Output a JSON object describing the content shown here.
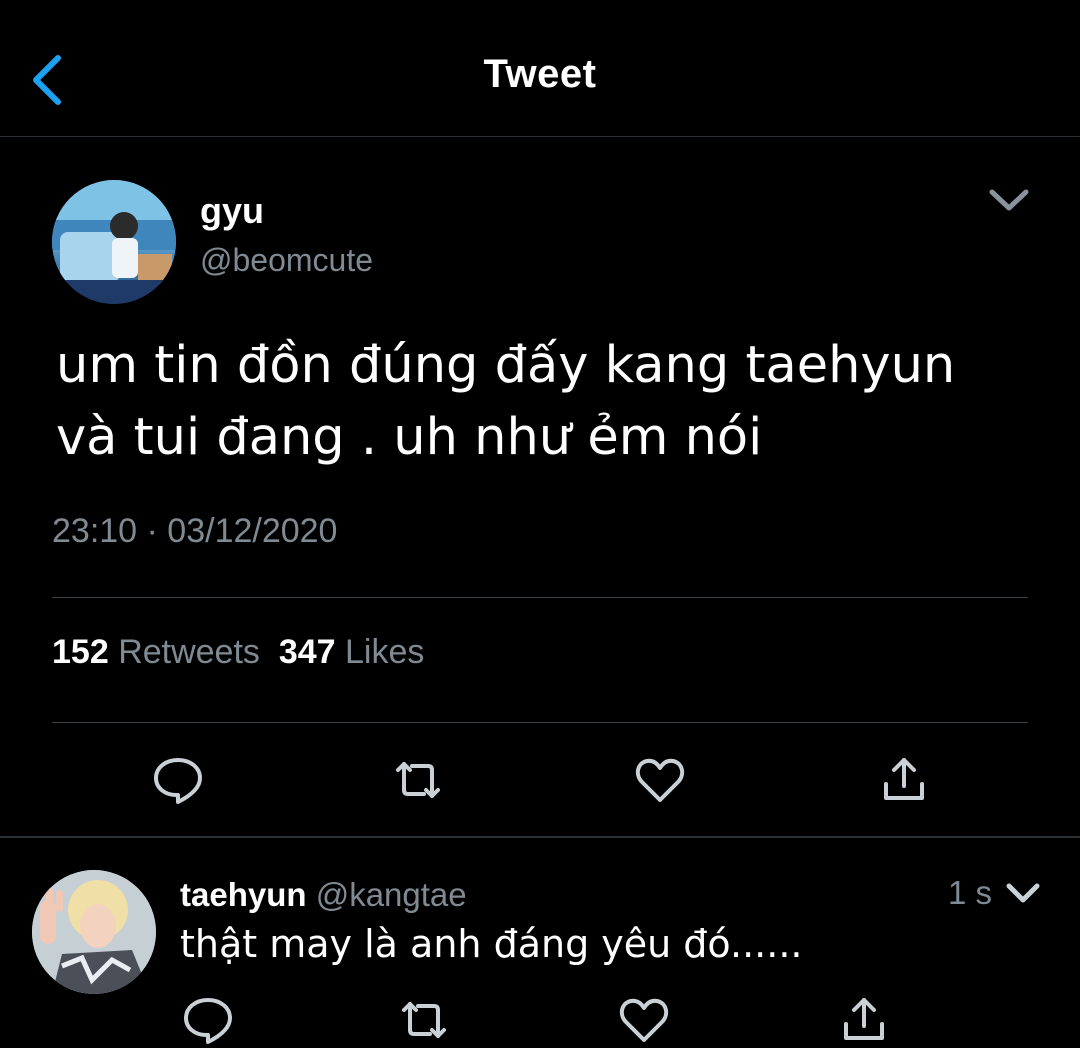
{
  "header": {
    "title": "Tweet"
  },
  "tweet": {
    "name": "gyu",
    "handle": "@beomcute",
    "text_line1": "um tin đồn đúng đấy kang taehyun",
    "text_line2": "và tui đang . uh như ẻm nói",
    "time": "23:10 · 03/12/2020",
    "retweets_count": "152",
    "retweets_label": "Retweets",
    "likes_count": "347",
    "likes_label": "Likes"
  },
  "reply": {
    "name": "taehyun",
    "handle": "@kangtae",
    "time": "1 s",
    "text": "thật may là anh đáng yêu đó......"
  },
  "icons": {
    "back": "chevron-left-icon",
    "menu": "chevron-down-icon",
    "reply": "comment-icon",
    "retweet": "retweet-icon",
    "like": "heart-icon",
    "share": "share-icon"
  },
  "colors": {
    "accent": "#1da1f2",
    "muted": "#7f8a93",
    "background": "#000000"
  }
}
